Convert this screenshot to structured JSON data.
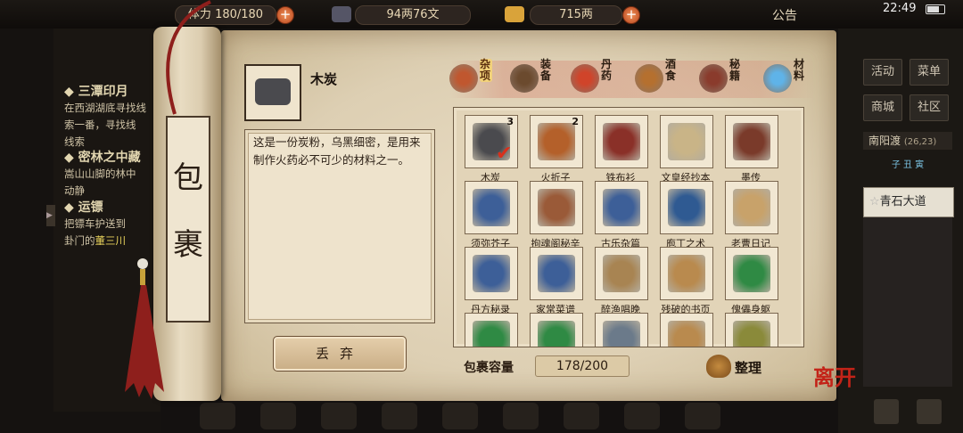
{
  "status_bar": {
    "stamina_label": "体力",
    "stamina": "180/180",
    "silver": "94两76文",
    "gold": "715两",
    "notice": "公告",
    "time": "22:49"
  },
  "quests": [
    {
      "title": "三潭印月",
      "desc_lines": [
        "在西湖湖底寻找线",
        "索一番，寻找线",
        "线索"
      ]
    },
    {
      "title": "密林之中藏",
      "desc_lines": [
        "嵩山山脚的林中",
        "动静"
      ]
    },
    {
      "title": "运镖",
      "desc_lines": [
        "把镖车护送到",
        "卦门的"
      ],
      "highlight": "董三川"
    }
  ],
  "right_nav": {
    "buttons": [
      "活动",
      "菜单",
      "商城",
      "社区"
    ],
    "location": "南阳渡",
    "coords": "(26,23)",
    "time_marker": "子 丑 寅",
    "road": "青石大道"
  },
  "scroll": {
    "title_chars": [
      "包",
      "裹"
    ]
  },
  "selected_item": {
    "name": "木炭",
    "description": "这是一份炭粉，乌黑细密，是用来制作火药必不可少的材料之一。"
  },
  "discard_label": "丢弃",
  "tabs": [
    {
      "label": "杂项",
      "color": "#c0572f",
      "active": true
    },
    {
      "label": "装备",
      "color": "#6b4a2e",
      "active": false
    },
    {
      "label": "丹药",
      "color": "#d0442a",
      "active": false
    },
    {
      "label": "酒食",
      "color": "#b5702f",
      "active": false
    },
    {
      "label": "秘籍",
      "color": "#8a3b2c",
      "active": false
    },
    {
      "label": "材料",
      "color": "#5fb3e8",
      "active": false
    }
  ],
  "items": [
    {
      "name": "木炭",
      "count": "3",
      "color": "#4a4a4e",
      "selected": true
    },
    {
      "name": "火折子",
      "count": "2",
      "color": "#b4602a",
      "selected": false
    },
    {
      "name": "铁布衫",
      "count": "",
      "color": "#8a3028",
      "selected": false
    },
    {
      "name": "文皇经抄本",
      "count": "",
      "color": "#c9b487",
      "selected": false
    },
    {
      "name": "墨传",
      "count": "",
      "color": "#7a3a2a",
      "selected": false
    },
    {
      "name": "须弥芥子",
      "count": "",
      "color": "#3d5f98",
      "selected": false
    },
    {
      "name": "拘魂阁秘辛",
      "count": "",
      "color": "#9a5a38",
      "selected": false
    },
    {
      "name": "古乐杂篇",
      "count": "",
      "color": "#3d5f98",
      "selected": false
    },
    {
      "name": "庖丁之术",
      "count": "",
      "color": "#2f5a92",
      "selected": false
    },
    {
      "name": "老曹日记",
      "count": "",
      "color": "#c8a26a",
      "selected": false
    },
    {
      "name": "丹方秘录",
      "count": "",
      "color": "#3d5f98",
      "selected": false
    },
    {
      "name": "家常菜谱",
      "count": "",
      "color": "#3d5f98",
      "selected": false
    },
    {
      "name": "醉渔唱晚",
      "count": "",
      "color": "#a88452",
      "selected": false
    },
    {
      "name": "残破的书页",
      "count": "",
      "color": "#b98a4e",
      "selected": false
    },
    {
      "name": "傀儡身躯",
      "count": "",
      "color": "#2f8a44",
      "selected": false
    },
    {
      "name": "",
      "count": "",
      "color": "#2f8a44",
      "selected": false
    },
    {
      "name": "",
      "count": "",
      "color": "#2f8a44",
      "selected": false
    },
    {
      "name": "",
      "count": "",
      "color": "#6b7a8a",
      "selected": false
    },
    {
      "name": "",
      "count": "",
      "color": "#b98a4e",
      "selected": false
    },
    {
      "name": "",
      "count": "",
      "color": "#8a8a3a",
      "selected": false
    }
  ],
  "capacity": {
    "label": "包裹容量",
    "value": "178/200"
  },
  "sort_label": "整理",
  "game_logo": "离开"
}
